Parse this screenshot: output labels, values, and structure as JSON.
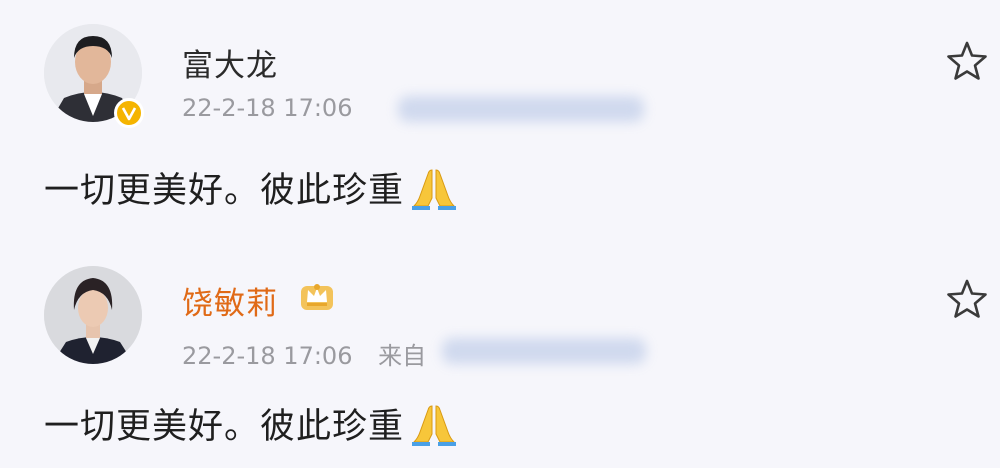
{
  "posts": [
    {
      "author": "富大龙",
      "time": "22-2-18 17:06",
      "source_label": "",
      "source_blurred": true,
      "text": "一切更美好。彼此珍重",
      "emoji": "folded-hands",
      "verified_badge": "gold-v",
      "name_color": "#2b2b2b"
    },
    {
      "author": "饶敏莉",
      "time": "22-2-18 17:06",
      "source_label": "来自",
      "source_blurred": true,
      "text": "一切更美好。彼此珍重",
      "emoji": "folded-hands",
      "member_badge": "crown",
      "name_color": "#e06a17"
    }
  ],
  "colors": {
    "background": "#f6f6fb",
    "verified": "#f5b400",
    "vip_name": "#e06a17",
    "timestamp": "#9a9a9f"
  },
  "icons": {
    "favorite": "star-outline-icon",
    "emoji": "folded-hands-emoji"
  }
}
